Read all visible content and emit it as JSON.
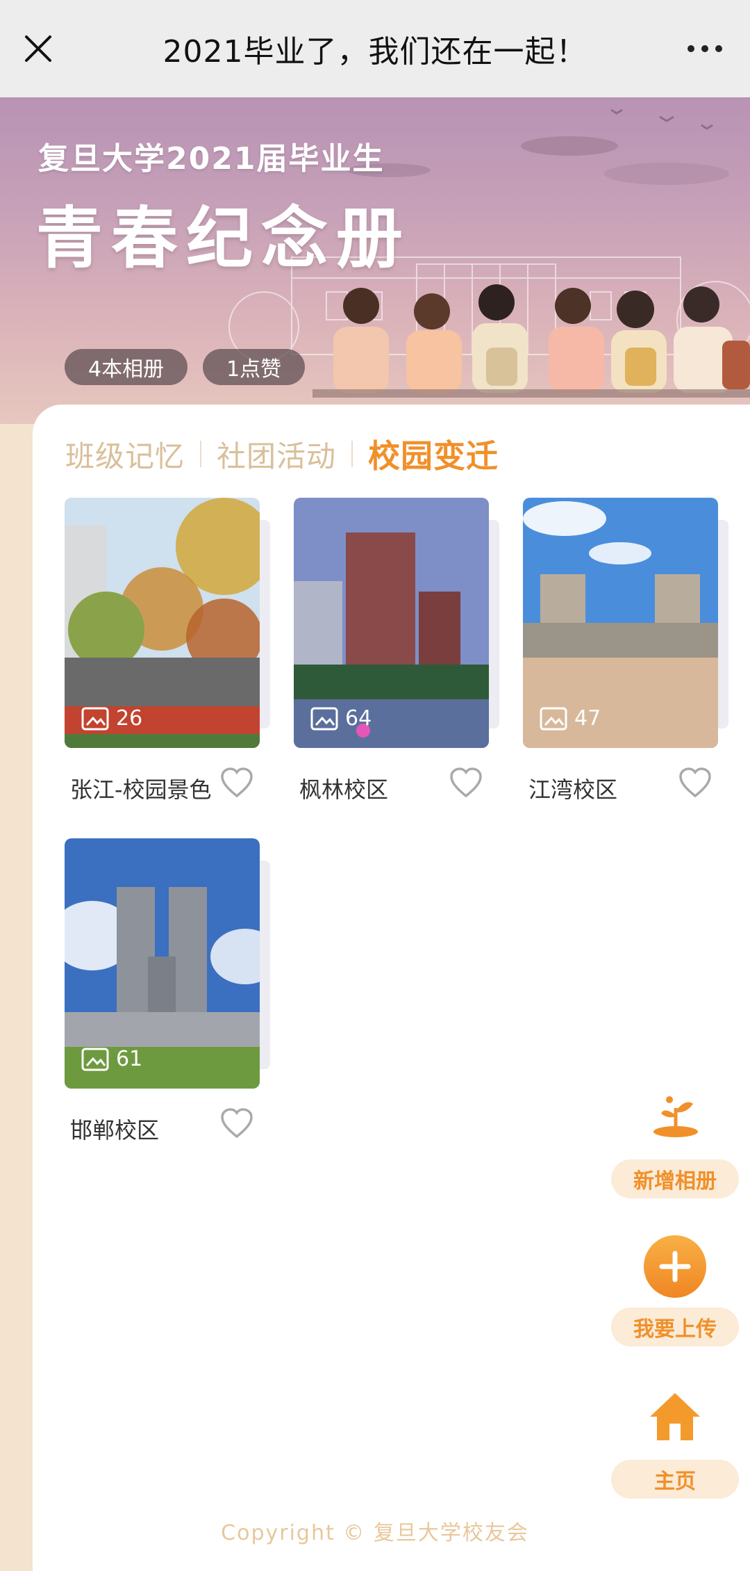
{
  "topbar": {
    "title": "2021毕业了，我们还在一起！"
  },
  "banner": {
    "subtitle": "复旦大学2021届毕业生",
    "main_title": "青春纪念册",
    "album_count": "4本相册",
    "likes": "1点赞"
  },
  "tabs": [
    {
      "label": "班级记忆",
      "active": false
    },
    {
      "label": "社团活动",
      "active": false
    },
    {
      "label": "校园变迁",
      "active": true
    }
  ],
  "albums": [
    {
      "name": "张江-校园景色",
      "count": "26"
    },
    {
      "name": "枫林校区",
      "count": "64"
    },
    {
      "name": "江湾校区",
      "count": "47"
    },
    {
      "name": "邯郸校区",
      "count": "61"
    }
  ],
  "actions": {
    "new_album": "新增相册",
    "upload": "我要上传",
    "home": "主页"
  },
  "copyright": "Copyright © 复旦大学校友会",
  "colors": {
    "accent": "#f0902a",
    "tab_inactive": "#d9bf9a",
    "action_bg": "#fbebd7"
  }
}
